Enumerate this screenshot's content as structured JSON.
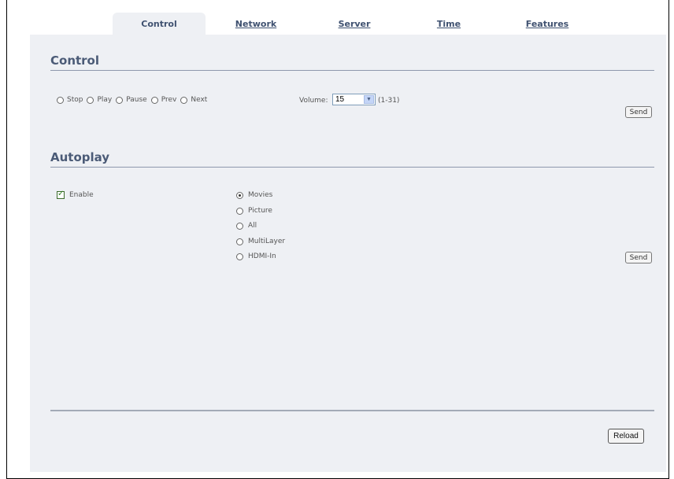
{
  "tabs": [
    {
      "label": "Control",
      "active": true
    },
    {
      "label": "Network",
      "active": false
    },
    {
      "label": "Server",
      "active": false
    },
    {
      "label": "Time",
      "active": false
    },
    {
      "label": "Features",
      "active": false
    }
  ],
  "control": {
    "title": "Control",
    "options": [
      "Stop",
      "Play",
      "Pause",
      "Prev",
      "Next"
    ],
    "volume_label": "Volume:",
    "volume_value": "15",
    "volume_range": "(1-31)",
    "send_label": "Send"
  },
  "autoplay": {
    "title": "Autoplay",
    "enable_label": "Enable",
    "enable_checked": true,
    "modes": [
      {
        "label": "Movies",
        "selected": true
      },
      {
        "label": "Picture",
        "selected": false
      },
      {
        "label": "All",
        "selected": false
      },
      {
        "label": "MultiLayer",
        "selected": false
      },
      {
        "label": "HDMI-In",
        "selected": false
      }
    ],
    "send_label": "Send"
  },
  "footer": {
    "reload_label": "Reload"
  }
}
